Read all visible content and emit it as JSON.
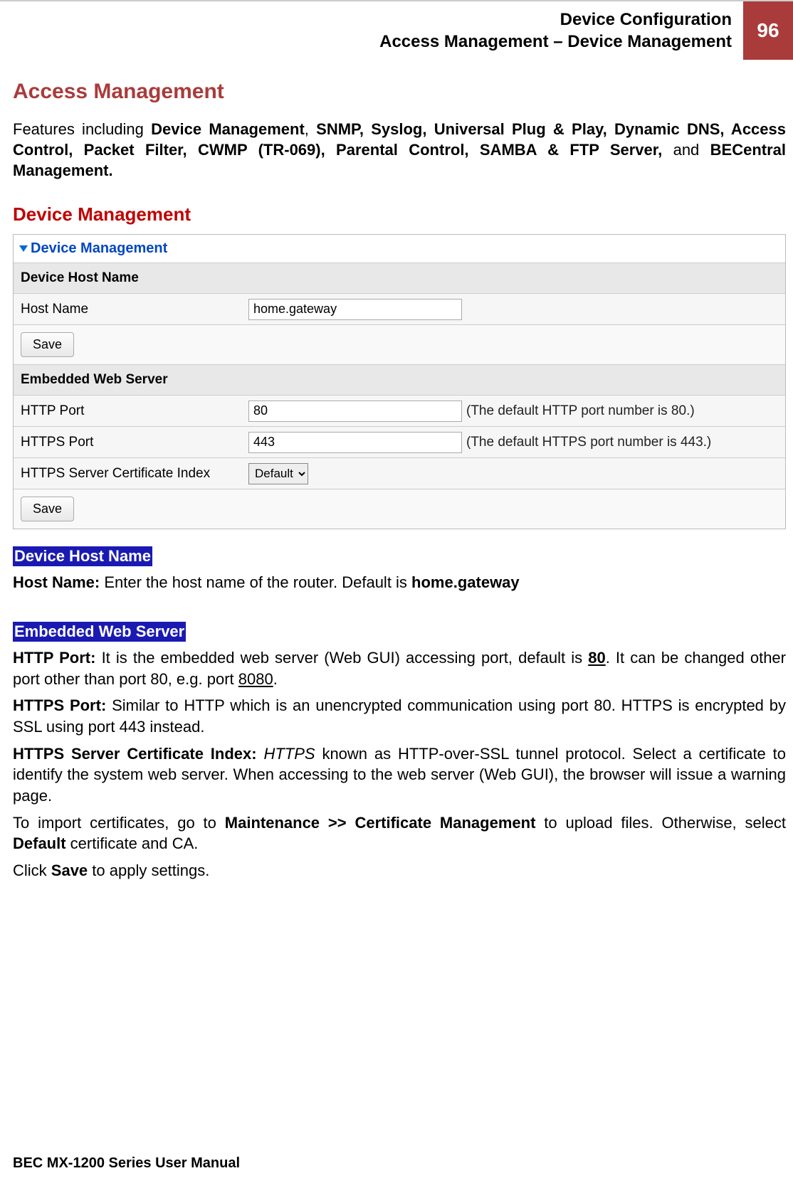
{
  "header": {
    "line1": "Device Configuration",
    "line2": "Access Management – Device Management",
    "page": "96"
  },
  "h1": "Access Management",
  "intro": {
    "pre": "Features including ",
    "bold1": "Device Management",
    "mid": ", ",
    "bold2": "SNMP, Syslog, Universal Plug & Play, Dynamic DNS, Access Control, Packet Filter, CWMP (TR-069), Parental Control, SAMBA & FTP Server, ",
    "and": "and ",
    "bold3": "BECentral Management."
  },
  "h2": "Device Management",
  "panel": {
    "title": "Device Management",
    "sec1": "Device Host Name",
    "hostname_label": "Host Name",
    "hostname_value": "home.gateway",
    "save1": "Save",
    "sec2": "Embedded Web Server",
    "http_label": "HTTP Port",
    "http_value": "80",
    "http_hint": "(The default HTTP port number is 80.)",
    "https_label": "HTTPS Port",
    "https_value": "443",
    "https_hint": "(The default HTTPS port number is 443.)",
    "cert_label": "HTTPS Server Certificate Index",
    "cert_value": "Default",
    "save2": "Save"
  },
  "band1": "Device Host Name",
  "hostname_desc": {
    "b1": "Host Name: ",
    "t1": "Enter the host name of the router. Default is ",
    "b2": "home.gateway"
  },
  "band2": "Embedded Web Server",
  "http_desc": {
    "b1": "HTTP Port: ",
    "t1": "It is the embedded web server (Web GUI) accessing port, default is ",
    "u1": "80",
    "t2": ". It can be changed other port other than port 80, e.g. port ",
    "u2": "8080",
    "t3": "."
  },
  "https_desc": {
    "b1": "HTTPS Port: ",
    "t1": "Similar to HTTP which is an unencrypted communication using port 80.  HTTPS is encrypted by SSL using port 443 instead."
  },
  "cert_desc": {
    "b1": "HTTPS Server Certificate Index: ",
    "i1": "HTTPS",
    "t1": " known as HTTP-over-SSL tunnel protocol. Select a certificate to identify the system web server.  When accessing to the web server (Web GUI), the browser will issue a warning page."
  },
  "import_desc": {
    "t1": "To import certificates, go to ",
    "b1": "Maintenance >> Certificate Management",
    "t2": " to upload files. Otherwise, select ",
    "b2": "Default",
    "t3": " certificate and CA."
  },
  "save_desc": {
    "t1": "Click ",
    "b1": "Save",
    "t2": " to apply settings."
  },
  "footer": "BEC MX-1200 Series User Manual"
}
